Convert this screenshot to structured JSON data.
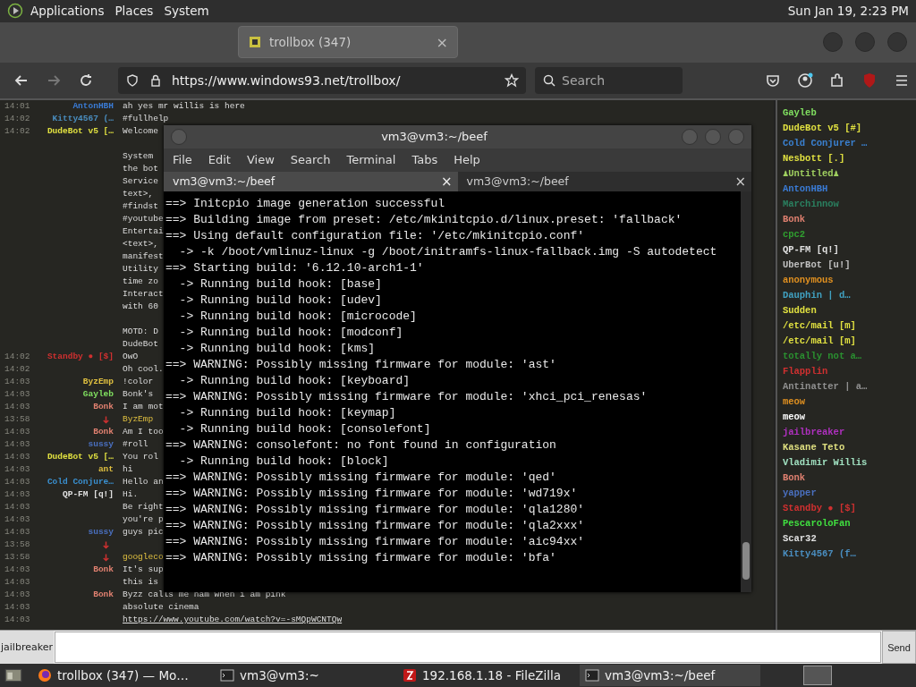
{
  "panel": {
    "menus": [
      "Applications",
      "Places",
      "System"
    ],
    "clock": "Sun Jan 19,  2:23 PM"
  },
  "browser": {
    "tabs": [
      {
        "label": "trollbox (347)",
        "selected": true,
        "close": "×"
      }
    ],
    "url": "https://www.windows93.net/trollbox/",
    "search": {
      "placeholder": "Search"
    }
  },
  "chat": {
    "rows": [
      {
        "kind": "message",
        "time": "14:01",
        "nick": "AntonHBH",
        "color": "#3a7bd5",
        "text": "ah yes mr willis is here"
      },
      {
        "kind": "message",
        "time": "14:02",
        "nick": "Kitty4567 (…",
        "color": "#4a8ec0",
        "text": "#fullhelp"
      },
      {
        "kind": "message",
        "time": "14:02",
        "nick": "DudeBot v5 […",
        "color": "#e0e040",
        "text": "Welcome"
      },
      {
        "kind": "blank"
      },
      {
        "kind": "continuation",
        "text": "System"
      },
      {
        "kind": "continuation",
        "text": "the bot"
      },
      {
        "kind": "continuation",
        "text": "Service"
      },
      {
        "kind": "continuation",
        "text": "text>,"
      },
      {
        "kind": "continuation",
        "text": "#findst"
      },
      {
        "kind": "continuation",
        "text": "#youtube"
      },
      {
        "kind": "continuation",
        "text": "Entertai"
      },
      {
        "kind": "continuation",
        "text": "<text>,"
      },
      {
        "kind": "continuation",
        "text": "manifest"
      },
      {
        "kind": "continuation",
        "text": "Utility"
      },
      {
        "kind": "continuation",
        "text": "time zo"
      },
      {
        "kind": "continuation",
        "text": "Interact"
      },
      {
        "kind": "continuation",
        "text": "with 60"
      },
      {
        "kind": "blank"
      },
      {
        "kind": "continuation",
        "text": "MOTD: D"
      },
      {
        "kind": "continuation",
        "text": "DudeBot"
      },
      {
        "kind": "message",
        "time": "14:02",
        "nick": "Standby ● [$]",
        "color": "#d03030",
        "text": "OwO"
      },
      {
        "kind": "message",
        "time": "14:02",
        "text": "Oh cool."
      },
      {
        "kind": "message",
        "time": "14:03",
        "nick": "ByzEmp",
        "color": "#e0c040",
        "text": "!color"
      },
      {
        "kind": "message",
        "time": "14:03",
        "nick": "Gayleb",
        "color": "#80e060",
        "text": "Bonk's"
      },
      {
        "kind": "message",
        "time": "14:03",
        "nick": "Bonk",
        "color": "#e08070",
        "text": "I am mot"
      },
      {
        "kind": "system",
        "time": "13:58",
        "text": "ByzEmp"
      },
      {
        "kind": "message",
        "time": "14:03",
        "nick": "Bonk",
        "color": "#e08070",
        "text": "Am I too"
      },
      {
        "kind": "message",
        "time": "14:03",
        "nick": "sussy",
        "color": "#4a70c0",
        "text": "#roll"
      },
      {
        "kind": "message",
        "time": "14:03",
        "nick": "DudeBot v5 […",
        "color": "#e0e040",
        "text": "You rol"
      },
      {
        "kind": "message",
        "time": "14:03",
        "nick": "ant",
        "color": "#e0c040",
        "text": "hi"
      },
      {
        "kind": "message",
        "time": "14:03",
        "nick": "Cold Conjure…",
        "color": "#3a90d0",
        "text": "Hello an"
      },
      {
        "kind": "message",
        "time": "14:03",
        "nick": "QP-FM [q!]",
        "color": "#e0e0e0",
        "text": "Hi."
      },
      {
        "kind": "message",
        "time": "14:03",
        "text": "Be right"
      },
      {
        "kind": "message",
        "time": "14:03",
        "text": "you're p"
      },
      {
        "kind": "message",
        "time": "14:03",
        "nick": "sussy",
        "color": "#4a70c0",
        "text": "guys pic"
      },
      {
        "kind": "system",
        "time": "13:58"
      },
      {
        "kind": "system",
        "time": "13:58",
        "text": "googleco"
      },
      {
        "kind": "message",
        "time": "14:03",
        "nick": "Bonk",
        "color": "#e08070",
        "text": "It's sup"
      },
      {
        "kind": "message",
        "time": "14:03",
        "text": "this is"
      },
      {
        "kind": "message",
        "time": "14:03",
        "nick": "Bonk",
        "color": "#e08070",
        "text": "Byzz calls me ham when i am pink"
      },
      {
        "kind": "message",
        "time": "14:03",
        "text": "absolute cinema"
      },
      {
        "kind": "link",
        "time": "14:03",
        "text": "https://www.youtube.com/watch?v=-sMQpWCNTQw"
      }
    ]
  },
  "users": [
    {
      "name": "Gayleb",
      "color": "#80e060"
    },
    {
      "name": "DudeBot v5 [#]",
      "color": "#e0e040"
    },
    {
      "name": "Cold Conjurer …",
      "color": "#3a80d0"
    },
    {
      "name": "Nesbott [.]",
      "color": "#e0e040"
    },
    {
      "name": "♟Untitled♟",
      "color": "#a0d060"
    },
    {
      "name": "AntonHBH",
      "color": "#3a7bd5"
    },
    {
      "name": "Marchinnow",
      "color": "#2a8060"
    },
    {
      "name": "Bonk",
      "color": "#e08070"
    },
    {
      "name": "cpc2",
      "color": "#30a030"
    },
    {
      "name": "QP-FM [q!]",
      "color": "#e0e0e0"
    },
    {
      "name": "UberBot [u!]",
      "color": "#c0c0c0"
    },
    {
      "name": "anonymous",
      "color": "#e09020"
    },
    {
      "name": "Dauphin | d…",
      "color": "#40a0c0"
    },
    {
      "name": "Sudden",
      "color": "#e0e040"
    },
    {
      "name": "/etc/mail [m]",
      "color": "#e0e040"
    },
    {
      "name": "/etc/mail [m]",
      "color": "#e0e040"
    },
    {
      "name": "totally not a…",
      "color": "#2a9030"
    },
    {
      "name": "Flapplin",
      "color": "#d03030"
    },
    {
      "name": "Antinatter | a…",
      "color": "#909090"
    },
    {
      "name": "meow",
      "color": "#e09020"
    },
    {
      "name": "meow",
      "color": "#ffffff"
    },
    {
      "name": "jailbreaker",
      "color": "#b030c0"
    },
    {
      "name": "Kasane Teto",
      "color": "#e0e080"
    },
    {
      "name": "Vladimir Willis",
      "color": "#a0e0c0"
    },
    {
      "name": "Bonk",
      "color": "#e08070"
    },
    {
      "name": "yapper",
      "color": "#4a70c0"
    },
    {
      "name": "Standby ● [$]",
      "color": "#d03030"
    },
    {
      "name": "PescaroloFan",
      "color": "#40e040"
    },
    {
      "name": "Scar32",
      "color": "#e0e0e0"
    },
    {
      "name": "Kitty4567 (f…",
      "color": "#4a8ec0"
    }
  ],
  "terminal": {
    "title": "vm3@vm3:~/beef",
    "menus": [
      "File",
      "Edit",
      "View",
      "Search",
      "Terminal",
      "Tabs",
      "Help"
    ],
    "tabs": [
      {
        "label": "vm3@vm3:~/beef",
        "selected": true,
        "close": "×"
      },
      {
        "label": "vm3@vm3:~/beef",
        "selected": false,
        "close": "×"
      }
    ],
    "lines": [
      "==> Initcpio image generation successful",
      "==> Building image from preset: /etc/mkinitcpio.d/linux.preset: 'fallback'",
      "==> Using default configuration file: '/etc/mkinitcpio.conf'",
      "  -> -k /boot/vmlinuz-linux -g /boot/initramfs-linux-fallback.img -S autodetect",
      "==> Starting build: '6.12.10-arch1-1'",
      "  -> Running build hook: [base]",
      "  -> Running build hook: [udev]",
      "  -> Running build hook: [microcode]",
      "  -> Running build hook: [modconf]",
      "  -> Running build hook: [kms]",
      "==> WARNING: Possibly missing firmware for module: 'ast'",
      "  -> Running build hook: [keyboard]",
      "==> WARNING: Possibly missing firmware for module: 'xhci_pci_renesas'",
      "  -> Running build hook: [keymap]",
      "  -> Running build hook: [consolefont]",
      "==> WARNING: consolefont: no font found in configuration",
      "  -> Running build hook: [block]",
      "==> WARNING: Possibly missing firmware for module: 'qed'",
      "==> WARNING: Possibly missing firmware for module: 'wd719x'",
      "==> WARNING: Possibly missing firmware for module: 'qla1280'",
      "==> WARNING: Possibly missing firmware for module: 'qla2xxx'",
      "==> WARNING: Possibly missing firmware for module: 'aic94xx'",
      "==> WARNING: Possibly missing firmware for module: 'bfa'"
    ]
  },
  "input": {
    "nick": "jailbreaker",
    "button": "Send"
  },
  "taskbar": [
    {
      "kind": "firefox",
      "label": "trollbox (347) — Mo…",
      "selected": false
    },
    {
      "kind": "terminal",
      "label": "vm3@vm3:~",
      "selected": false
    },
    {
      "kind": "filezilla",
      "label": "192.168.1.18 - FileZilla",
      "selected": false
    },
    {
      "kind": "terminal",
      "label": "vm3@vm3:~/beef",
      "selected": true
    }
  ]
}
